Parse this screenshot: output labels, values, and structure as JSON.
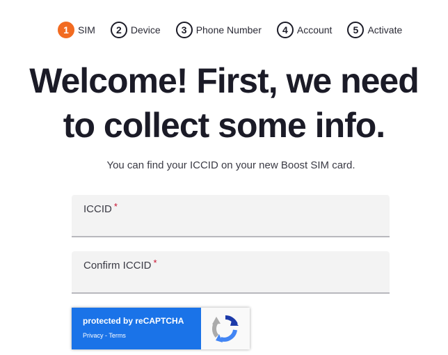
{
  "steps": [
    {
      "number": "1",
      "label": "SIM",
      "active": true
    },
    {
      "number": "2",
      "label": "Device"
    },
    {
      "number": "3",
      "label": "Phone Number"
    },
    {
      "number": "4",
      "label": "Account"
    },
    {
      "number": "5",
      "label": "Activate"
    }
  ],
  "headline": {
    "line1": "Welcome! First, we need",
    "line2": "to collect some info."
  },
  "subtitle": "You can find your ICCID on your new Boost SIM card.",
  "form": {
    "iccid": {
      "label": "ICCID",
      "required_mark": "*",
      "value": ""
    },
    "confirm_iccid": {
      "label": "Confirm ICCID",
      "required_mark": "*",
      "value": ""
    }
  },
  "recaptcha": {
    "title": "protected by reCAPTCHA",
    "privacy": "Privacy",
    "separator": " - ",
    "terms": "Terms",
    "icon": "recaptcha-logo"
  },
  "colors": {
    "accent": "#f26b21",
    "required": "#c8102e",
    "recaptcha_blue": "#1a73e8"
  }
}
